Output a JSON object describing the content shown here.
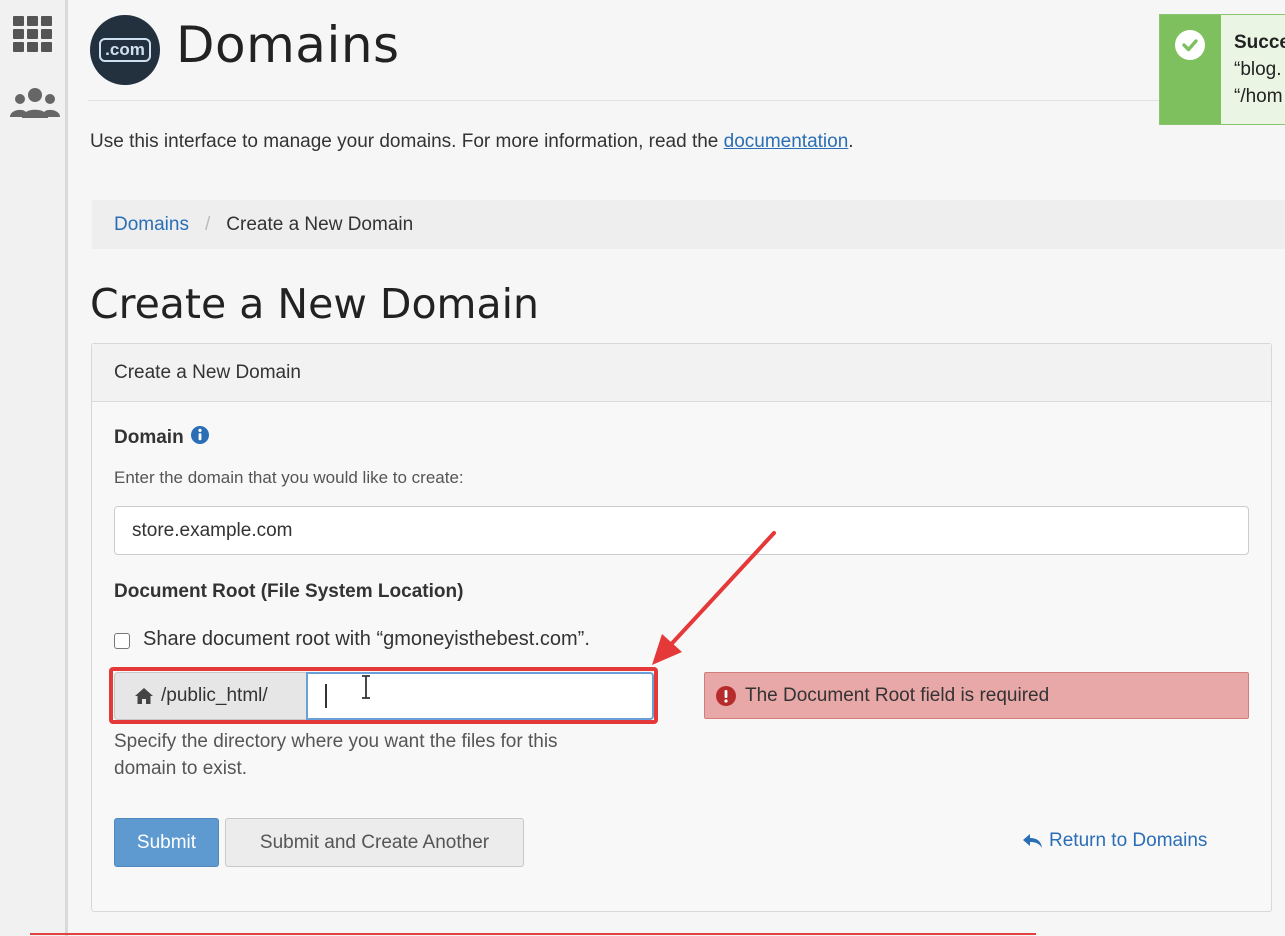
{
  "header": {
    "logo_text": ".com",
    "title": "Domains"
  },
  "toast": {
    "title": "Succe",
    "line1": "“blog.",
    "line2": "“/hom"
  },
  "intro": {
    "text": "Use this interface to manage your domains. For more information, read the ",
    "link": "documentation",
    "suffix": "."
  },
  "breadcrumb": {
    "parent": "Domains",
    "separator": "/",
    "current": "Create a New Domain"
  },
  "section_title": "Create a New Domain",
  "panel": {
    "heading": "Create a New Domain",
    "domain_label": "Domain",
    "domain_help": "Enter the domain that you would like to create:",
    "domain_value": "store.example.com",
    "docroot_label": "Document Root (File System Location)",
    "share_label": "Share document root with “gmoneyisthebest.com”.",
    "docroot_prefix": "/public_html/",
    "docroot_value": "",
    "docroot_help_line1": "Specify the directory where you want the files for this",
    "docroot_help_line2": "domain to exist.",
    "error": "The Document Root field is required",
    "submit": "Submit",
    "submit_another": "Submit and Create Another",
    "return_link": "Return to Domains"
  },
  "colors": {
    "accent": "#2a6eb6",
    "primary_button": "#5e9ad0",
    "error_bg": "#e8a8a8",
    "success": "#7fc05e",
    "annotation": "#e53838"
  },
  "icons": [
    "grid-icon",
    "users-icon",
    "check-circle-icon",
    "info-icon",
    "home-icon",
    "exclamation-circle-icon",
    "reply-arrow-icon"
  ]
}
